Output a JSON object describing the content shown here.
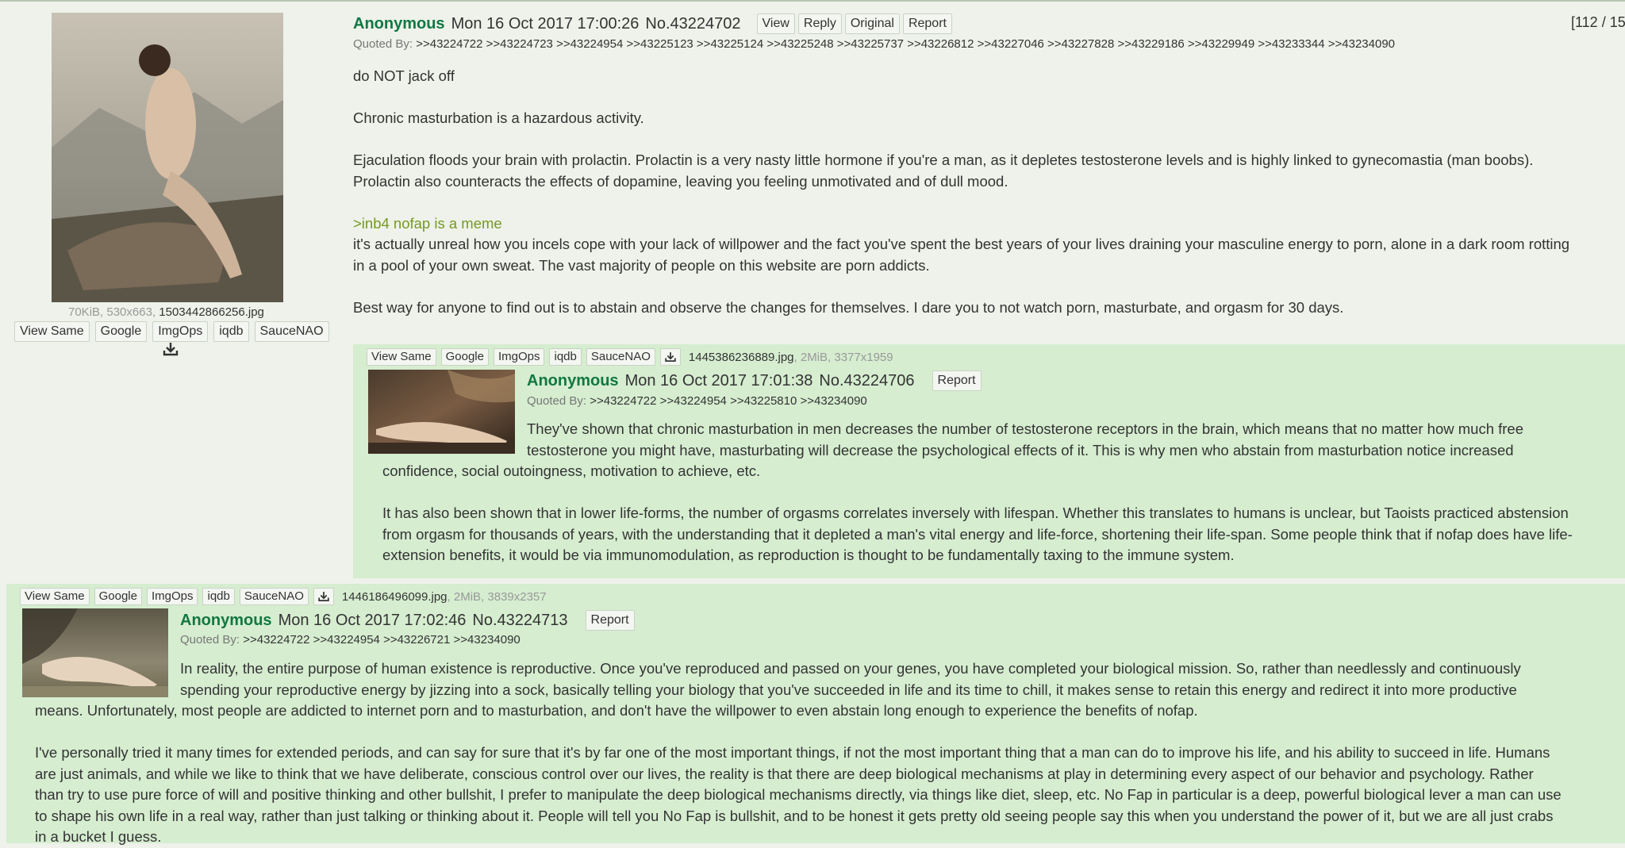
{
  "page_counter": "[112 / 15",
  "tool_buttons": [
    "View Same",
    "Google",
    "ImgOps",
    "iqdb",
    "SauceNAO"
  ],
  "icons": {
    "download": "download-icon"
  },
  "op": {
    "file_size": "70KiB, 530x663,",
    "file_name": "1503442866256.jpg",
    "name": "Anonymous",
    "date": "Mon 16 Oct 2017 17:00:26",
    "number": "No.43224702",
    "buttons": [
      "View",
      "Reply",
      "Original",
      "Report"
    ],
    "quoted_by_label": "Quoted By:",
    "quoted_by": ">>43224722 >>43224723 >>43224954 >>43225123 >>43225124 >>43225248 >>43225737 >>43226812 >>43227046 >>43227828 >>43229186 >>43229949 >>43233344 >>43234090",
    "lines": [
      "do NOT jack off",
      "Chronic masturbation is a hazardous activity.",
      "Ejaculation floods your brain with prolactin. Prolactin is a very nasty little hormone if you're a man, as it depletes testosterone levels and is highly linked to gynecomastia (man boobs).",
      "Prolactin also counteracts the effects of dopamine, leaving you feeling unmotivated and of dull mood.",
      ">inb4 nofap is a meme",
      "it's actually unreal how you incels cope with your lack of willpower and the fact you've spent the best years of your lives draining your masculine energy to porn, alone in a dark room rotting",
      "in a pool of your own sweat. The vast majority of people on this website are porn addicts.",
      "Best way for anyone to find out is to abstain and observe the changes for themselves. I dare you to not watch porn, masturbate, and orgasm for 30 days."
    ]
  },
  "reply1": {
    "file_name": "1445386236889.jpg",
    "file_meta": ", 2MiB, 3377x1959",
    "name": "Anonymous",
    "date": "Mon 16 Oct 2017 17:01:38",
    "number": "No.43224706",
    "report": "Report",
    "quoted_by_label": "Quoted By:",
    "quoted_by": ">>43224722 >>43224954 >>43225810 >>43234090",
    "lines": [
      "They've shown that chronic masturbation in men decreases the number of testosterone receptors in the brain, which means that no matter how much free",
      "testosterone you might have, masturbating will decrease the psychological effects of it. This is why men who abstain from masturbation notice increased",
      "confidence, social outoingness, motivation to achieve, etc.",
      "It has also been shown that in lower life-forms, the number of orgasms correlates inversely with lifespan. Whether this translates to humans is unclear, but Taoists practiced abstension",
      "from orgasm for thousands of years, with the understanding that it depleted a man's vital energy and life-force, shortening their life-span. Some people think that if nofap does have life-",
      "extension benefits, it would be via immunomodulation, as reproduction is thought to be fundamentally taxing to the immune system."
    ]
  },
  "reply2": {
    "file_name": "1446186496099.jpg",
    "file_meta": ", 2MiB, 3839x2357",
    "name": "Anonymous",
    "date": "Mon 16 Oct 2017 17:02:46",
    "number": "No.43224713",
    "report": "Report",
    "quoted_by_label": "Quoted By:",
    "quoted_by": ">>43224722 >>43224954 >>43226721 >>43234090",
    "lines": [
      "In reality, the entire purpose of human existence is reproductive. Once you've reproduced and passed on your genes, you have completed your biological mission. So, rather than needlessly and continuously",
      "spending your reproductive energy by jizzing into a sock, basically telling your biology that you've succeeded in life and its time to chill, it makes sense to retain this energy and redirect it into more productive",
      "means. Unfortunately, most people are addicted to internet porn and to masturbation, and don't have the willpower to even abstain long enough to experience the benefits of nofap.",
      "I've personally tried it many times for extended periods, and can say for sure that it's by far one of the most important things, if not the most important thing that a man can do to improve his life, and his ability to succeed in life. Humans",
      "are just animals, and while we like to think that we have deliberate, conscious control over our lives, the reality is that there are deep biological mechanisms at play in determining every aspect of our behavior and psychology. Rather",
      "than try to use pure force of will and positive thinking and other bullshit, I prefer to manipulate the deep biological mechanisms directly, via things like diet, sleep, etc. No Fap in particular is a deep, powerful biological lever a man can use",
      "to shape his own life in a real way, rather than just talking or thinking about it. People will tell you No Fap is bullshit, and to be honest it gets pretty old seeing people say this when you understand the power of it, but we are all just crabs",
      "in a bucket I guess."
    ]
  }
}
